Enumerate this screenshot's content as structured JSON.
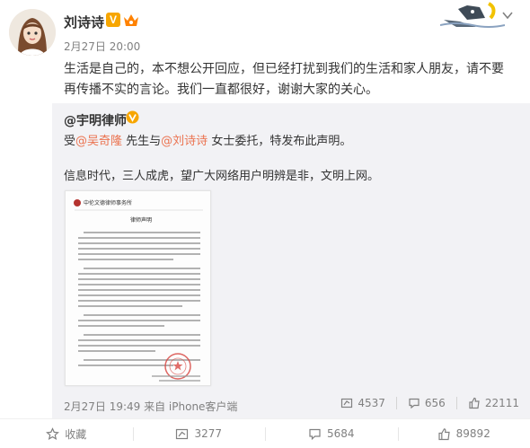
{
  "post": {
    "author_name": "刘诗诗",
    "vip_mark": "V",
    "time": "2月27日 20:00",
    "text": "生活是自己的，本不想公开回应，但已经打扰到我们的生活和家人朋友，请不要再传播不实的言论。我们一直都很好，谢谢大家的关心。"
  },
  "repost": {
    "author": "@宇明律师",
    "line1_prefix": "受",
    "mention1": "@吴奇隆",
    "line1_mid": " 先生与",
    "mention2": "@刘诗诗",
    "line1_suffix": " 女士委托，特发布此声明。",
    "line2": "信息时代，三人成虎，望广大网络用户明辨是非，文明上网。",
    "meta": "2月27日 19:49 来自 iPhone客户端",
    "reposts": "4537",
    "comments": "656",
    "likes": "22111"
  },
  "document": {
    "firm_name": "中伦文德律师事务所",
    "title": "律师声明"
  },
  "actions": {
    "favorite_label": "收藏",
    "repost_count": "3277",
    "comment_count": "5684",
    "like_count": "89892"
  },
  "icons": [
    "vip-icon",
    "member-icon",
    "chevron-down-icon",
    "repost-icon",
    "comment-icon",
    "like-icon",
    "favorite-icon"
  ],
  "colors": {
    "mention": "#eb7350",
    "vip": "#f7a600",
    "repost_bg": "#f2f2f5",
    "muted": "#808080"
  }
}
